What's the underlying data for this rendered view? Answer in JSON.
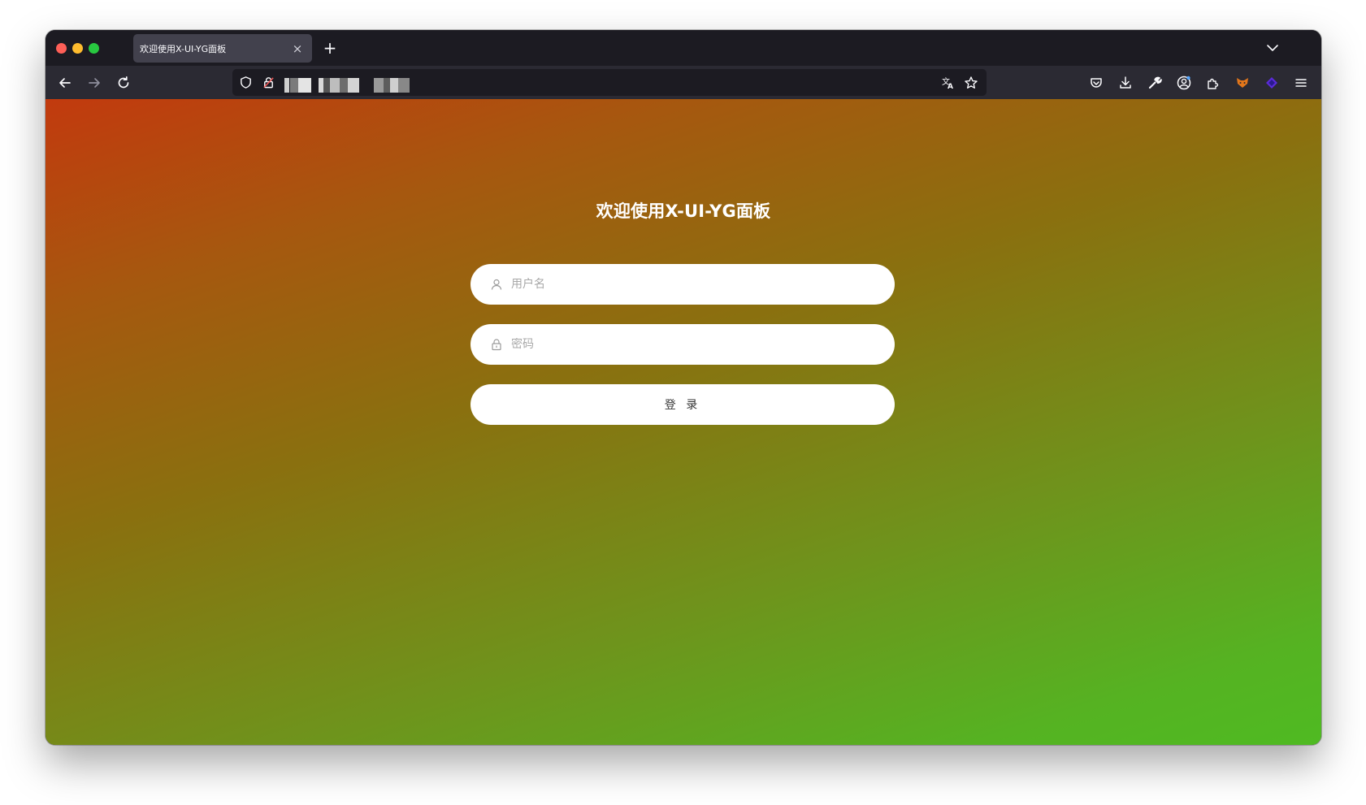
{
  "browser": {
    "tab": {
      "title": "欢迎使用X-UI-YG面板",
      "close_glyph": "×"
    },
    "new_tab_glyph": "+",
    "nav": {
      "back": "arrow-left-icon",
      "forward": "arrow-right-icon",
      "reload": "reload-icon"
    },
    "urlbar": {
      "url_redacted": true
    },
    "toolbar_icons": [
      "translate-icon",
      "star-icon",
      "pocket-icon",
      "download-icon",
      "wrench-icon",
      "account-icon",
      "extensions-icon",
      "fox-extension-icon",
      "purple-extension-icon",
      "menu-icon"
    ]
  },
  "login": {
    "title": "欢迎使用X-UI-YG面板",
    "username_placeholder": "用户名",
    "password_placeholder": "密码",
    "submit_label": "登 录"
  },
  "colors": {
    "gradient_start": "#c23a0e",
    "gradient_end": "#4fba22",
    "field_bg": "#ffffff"
  }
}
